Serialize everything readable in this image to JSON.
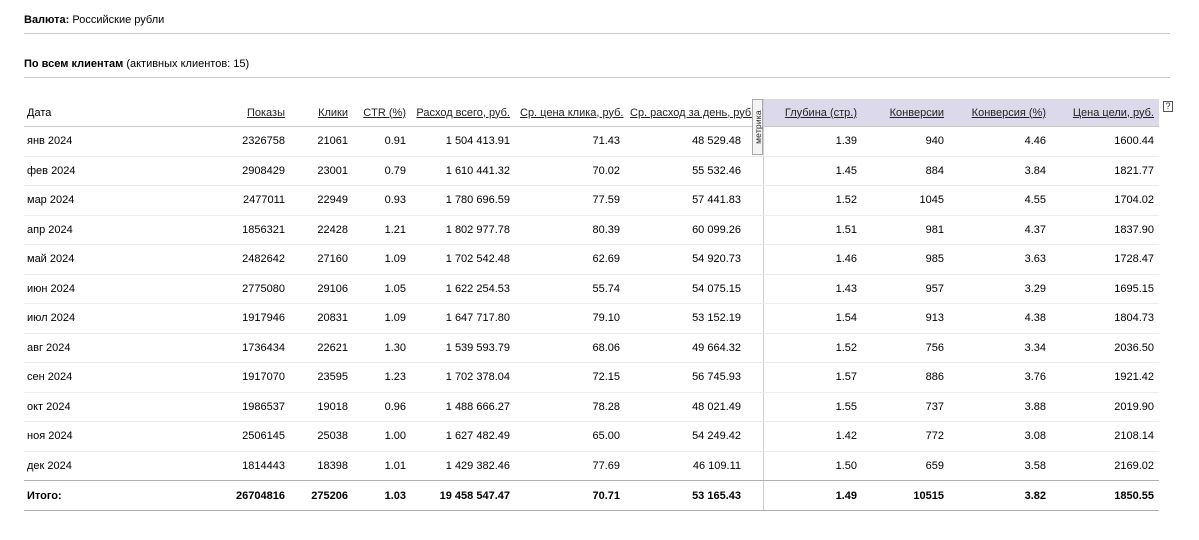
{
  "currency": {
    "label": "Валюта:",
    "value": "Российские рубли"
  },
  "clients": {
    "label": "По всем клиентам",
    "note": "(активных клиентов: 15)"
  },
  "metrika_tab_label": "метрика",
  "help_icon_label": "?",
  "table": {
    "columns": [
      "Дата",
      "Показы",
      "Клики",
      "CTR (%)",
      "Расход всего, руб.",
      "Ср. цена клика, руб.",
      "Ср. расход за день, руб.",
      "Глубина (стр.)",
      "Конверсии",
      "Конверсия (%)",
      "Цена цели, руб."
    ],
    "rows": [
      [
        "янв 2024",
        "2326758",
        "21061",
        "0.91",
        "1 504 413.91",
        "71.43",
        "48 529.48",
        "1.39",
        "940",
        "4.46",
        "1600.44"
      ],
      [
        "фев 2024",
        "2908429",
        "23001",
        "0.79",
        "1 610 441.32",
        "70.02",
        "55 532.46",
        "1.45",
        "884",
        "3.84",
        "1821.77"
      ],
      [
        "мар 2024",
        "2477011",
        "22949",
        "0.93",
        "1 780 696.59",
        "77.59",
        "57 441.83",
        "1.52",
        "1045",
        "4.55",
        "1704.02"
      ],
      [
        "апр 2024",
        "1856321",
        "22428",
        "1.21",
        "1 802 977.78",
        "80.39",
        "60 099.26",
        "1.51",
        "981",
        "4.37",
        "1837.90"
      ],
      [
        "май 2024",
        "2482642",
        "27160",
        "1.09",
        "1 702 542.48",
        "62.69",
        "54 920.73",
        "1.46",
        "985",
        "3.63",
        "1728.47"
      ],
      [
        "июн 2024",
        "2775080",
        "29106",
        "1.05",
        "1 622 254.53",
        "55.74",
        "54 075.15",
        "1.43",
        "957",
        "3.29",
        "1695.15"
      ],
      [
        "июл 2024",
        "1917946",
        "20831",
        "1.09",
        "1 647 717.80",
        "79.10",
        "53 152.19",
        "1.54",
        "913",
        "4.38",
        "1804.73"
      ],
      [
        "авг 2024",
        "1736434",
        "22621",
        "1.30",
        "1 539 593.79",
        "68.06",
        "49 664.32",
        "1.52",
        "756",
        "3.34",
        "2036.50"
      ],
      [
        "сен 2024",
        "1917070",
        "23595",
        "1.23",
        "1 702 378.04",
        "72.15",
        "56 745.93",
        "1.57",
        "886",
        "3.76",
        "1921.42"
      ],
      [
        "окт 2024",
        "1986537",
        "19018",
        "0.96",
        "1 488 666.27",
        "78.28",
        "48 021.49",
        "1.55",
        "737",
        "3.88",
        "2019.90"
      ],
      [
        "ноя 2024",
        "2506145",
        "25038",
        "1.00",
        "1 627 482.49",
        "65.00",
        "54 249.42",
        "1.42",
        "772",
        "3.08",
        "2108.14"
      ],
      [
        "дек 2024",
        "1814443",
        "18398",
        "1.01",
        "1 429 382.46",
        "77.69",
        "46 109.11",
        "1.50",
        "659",
        "3.58",
        "2169.02"
      ]
    ],
    "total": [
      "Итого:",
      "26704816",
      "275206",
      "1.03",
      "19 458 547.47",
      "70.71",
      "53 165.43",
      "1.49",
      "10515",
      "3.82",
      "1850.55"
    ]
  }
}
